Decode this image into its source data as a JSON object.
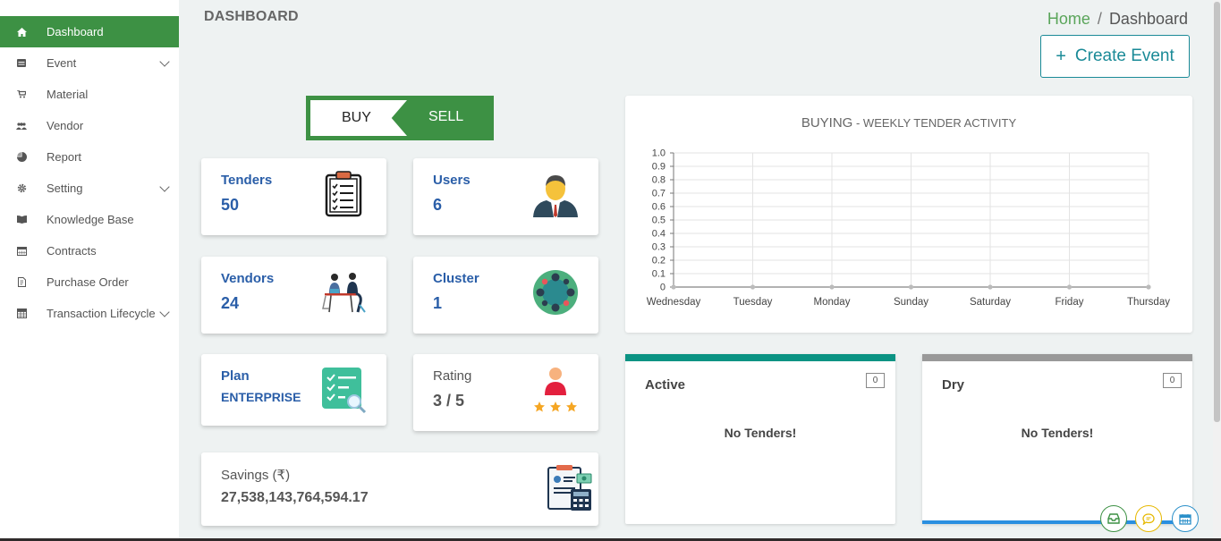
{
  "sidebar": {
    "items": [
      {
        "label": "Dashboard",
        "icon": "home-icon"
      },
      {
        "label": "Event",
        "icon": "event-icon"
      },
      {
        "label": "Material",
        "icon": "cart-icon"
      },
      {
        "label": "Vendor",
        "icon": "users-icon"
      },
      {
        "label": "Report",
        "icon": "pie-icon"
      },
      {
        "label": "Setting",
        "icon": "gear-icon"
      },
      {
        "label": "Knowledge Base",
        "icon": "book-icon"
      },
      {
        "label": "Contracts",
        "icon": "calendar-icon"
      },
      {
        "label": "Purchase Order",
        "icon": "document-icon"
      },
      {
        "label": "Transaction Lifecycle",
        "icon": "table-icon"
      }
    ]
  },
  "header": {
    "title": "DASHBOARD",
    "breadcrumb": {
      "home": "Home",
      "separator": "/",
      "current": "Dashboard"
    },
    "create_button": {
      "plus": "+",
      "label": "Create Event"
    }
  },
  "toggle": {
    "buy": "BUY",
    "sell": "SELL"
  },
  "stats": {
    "tenders": {
      "label": "Tenders",
      "value": "50"
    },
    "users": {
      "label": "Users",
      "value": "6"
    },
    "vendors": {
      "label": "Vendors",
      "value": "24"
    },
    "cluster": {
      "label": "Cluster",
      "value": "1"
    },
    "plan": {
      "label": "Plan",
      "value": "ENTERPRISE"
    },
    "rating": {
      "label": "Rating",
      "value": "3 / 5",
      "stars": 3
    },
    "savings": {
      "label": "Savings (₹)",
      "value": "27,538,143,764,594.17"
    }
  },
  "chart_title": {
    "main": "BUYING",
    "sep": " - ",
    "sub": "WEEKLY TENDER ACTIVITY"
  },
  "chart_data": {
    "type": "line",
    "title": "BUYING - WEEKLY TENDER ACTIVITY",
    "categories": [
      "Wednesday",
      "Tuesday",
      "Monday",
      "Sunday",
      "Saturday",
      "Friday",
      "Thursday"
    ],
    "series": [
      {
        "values": [
          0,
          0,
          0,
          0,
          0,
          0,
          0
        ]
      }
    ],
    "ylim": [
      0,
      1.0
    ],
    "yticks": [
      "0",
      "0.1",
      "0.2",
      "0.3",
      "0.4",
      "0.5",
      "0.6",
      "0.7",
      "0.8",
      "0.9",
      "1.0"
    ],
    "grid": true,
    "colors": {
      "line": "#999999",
      "grid": "#e3e3e3",
      "axis": "#777777"
    }
  },
  "status_panels": {
    "active": {
      "title": "Active",
      "count": "0",
      "empty": "No Tenders!",
      "color": "#0a9383"
    },
    "dry": {
      "title": "Dry",
      "count": "0",
      "empty": "No Tenders!",
      "color": "#999999"
    }
  },
  "colors": {
    "brand": "#3d9144",
    "link": "#2a5ea8",
    "accent": "#1a8a97"
  },
  "fabs": [
    {
      "icon": "inbox-icon",
      "color": "#3d9144"
    },
    {
      "icon": "chat-icon",
      "color": "#e6b800"
    },
    {
      "icon": "calendar-icon",
      "color": "#2a8fc9"
    }
  ]
}
